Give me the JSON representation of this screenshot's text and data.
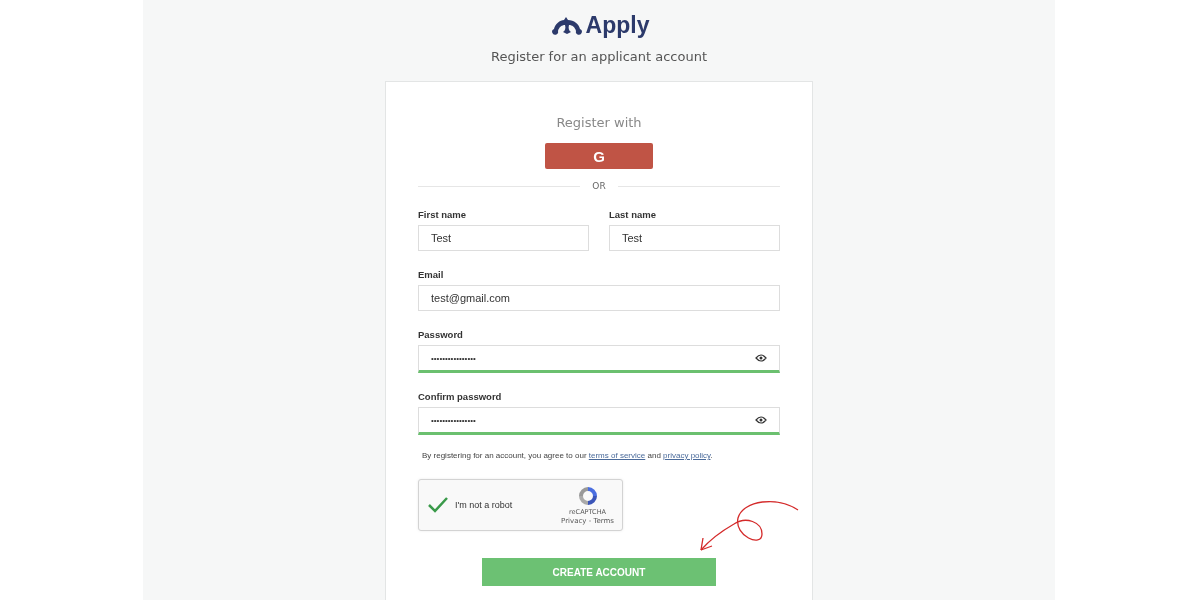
{
  "header": {
    "logo_text": "Apply",
    "subtitle": "Register for an applicant account"
  },
  "social": {
    "heading": "Register with",
    "google_button": "G",
    "divider": "OR"
  },
  "name_fields": [
    {
      "label": "First name",
      "value": "Test"
    },
    {
      "label": "Last name",
      "value": "Test"
    }
  ],
  "fields": [
    {
      "label": "Email",
      "value": "test@gmail.com",
      "kind": "text",
      "valid": false
    },
    {
      "label": "Password",
      "value": "••••••••••••••••",
      "kind": "password",
      "valid": true
    },
    {
      "label": "Confirm password",
      "value": "••••••••••••••••",
      "kind": "password",
      "valid": true
    }
  ],
  "terms": {
    "before": "By registering for an account, you agree to our",
    "link_1": "terms of service",
    "middle": "and",
    "link_2": "privacy policy",
    "after": "."
  },
  "captcha": {
    "label": "I'm not a robot",
    "checked": true,
    "brand": "reCAPTCHA",
    "links": "Privacy - Terms"
  },
  "submit_button": "CREATE ACCOUNT"
}
